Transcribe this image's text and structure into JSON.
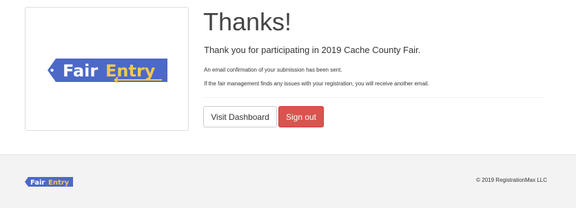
{
  "logo": {
    "word1": "Fair",
    "word2": "Entry",
    "colors": {
      "ticket": "#4c69c7",
      "word1": "#ffffff",
      "word2": "#f6c84c"
    }
  },
  "main": {
    "title": "Thanks!",
    "lead": "Thank you for participating in 2019 Cache County Fair.",
    "notice_1": "An email confirmation of your submission has been sent.",
    "notice_2": "If the fair management finds any issues with your registration, you will receive another email."
  },
  "actions": {
    "visit_dashboard": "Visit Dashboard",
    "sign_out": "Sign out",
    "sign_out_color": "#d9534f"
  },
  "footer": {
    "copyright": "© 2019 RegistrationMax LLC"
  }
}
